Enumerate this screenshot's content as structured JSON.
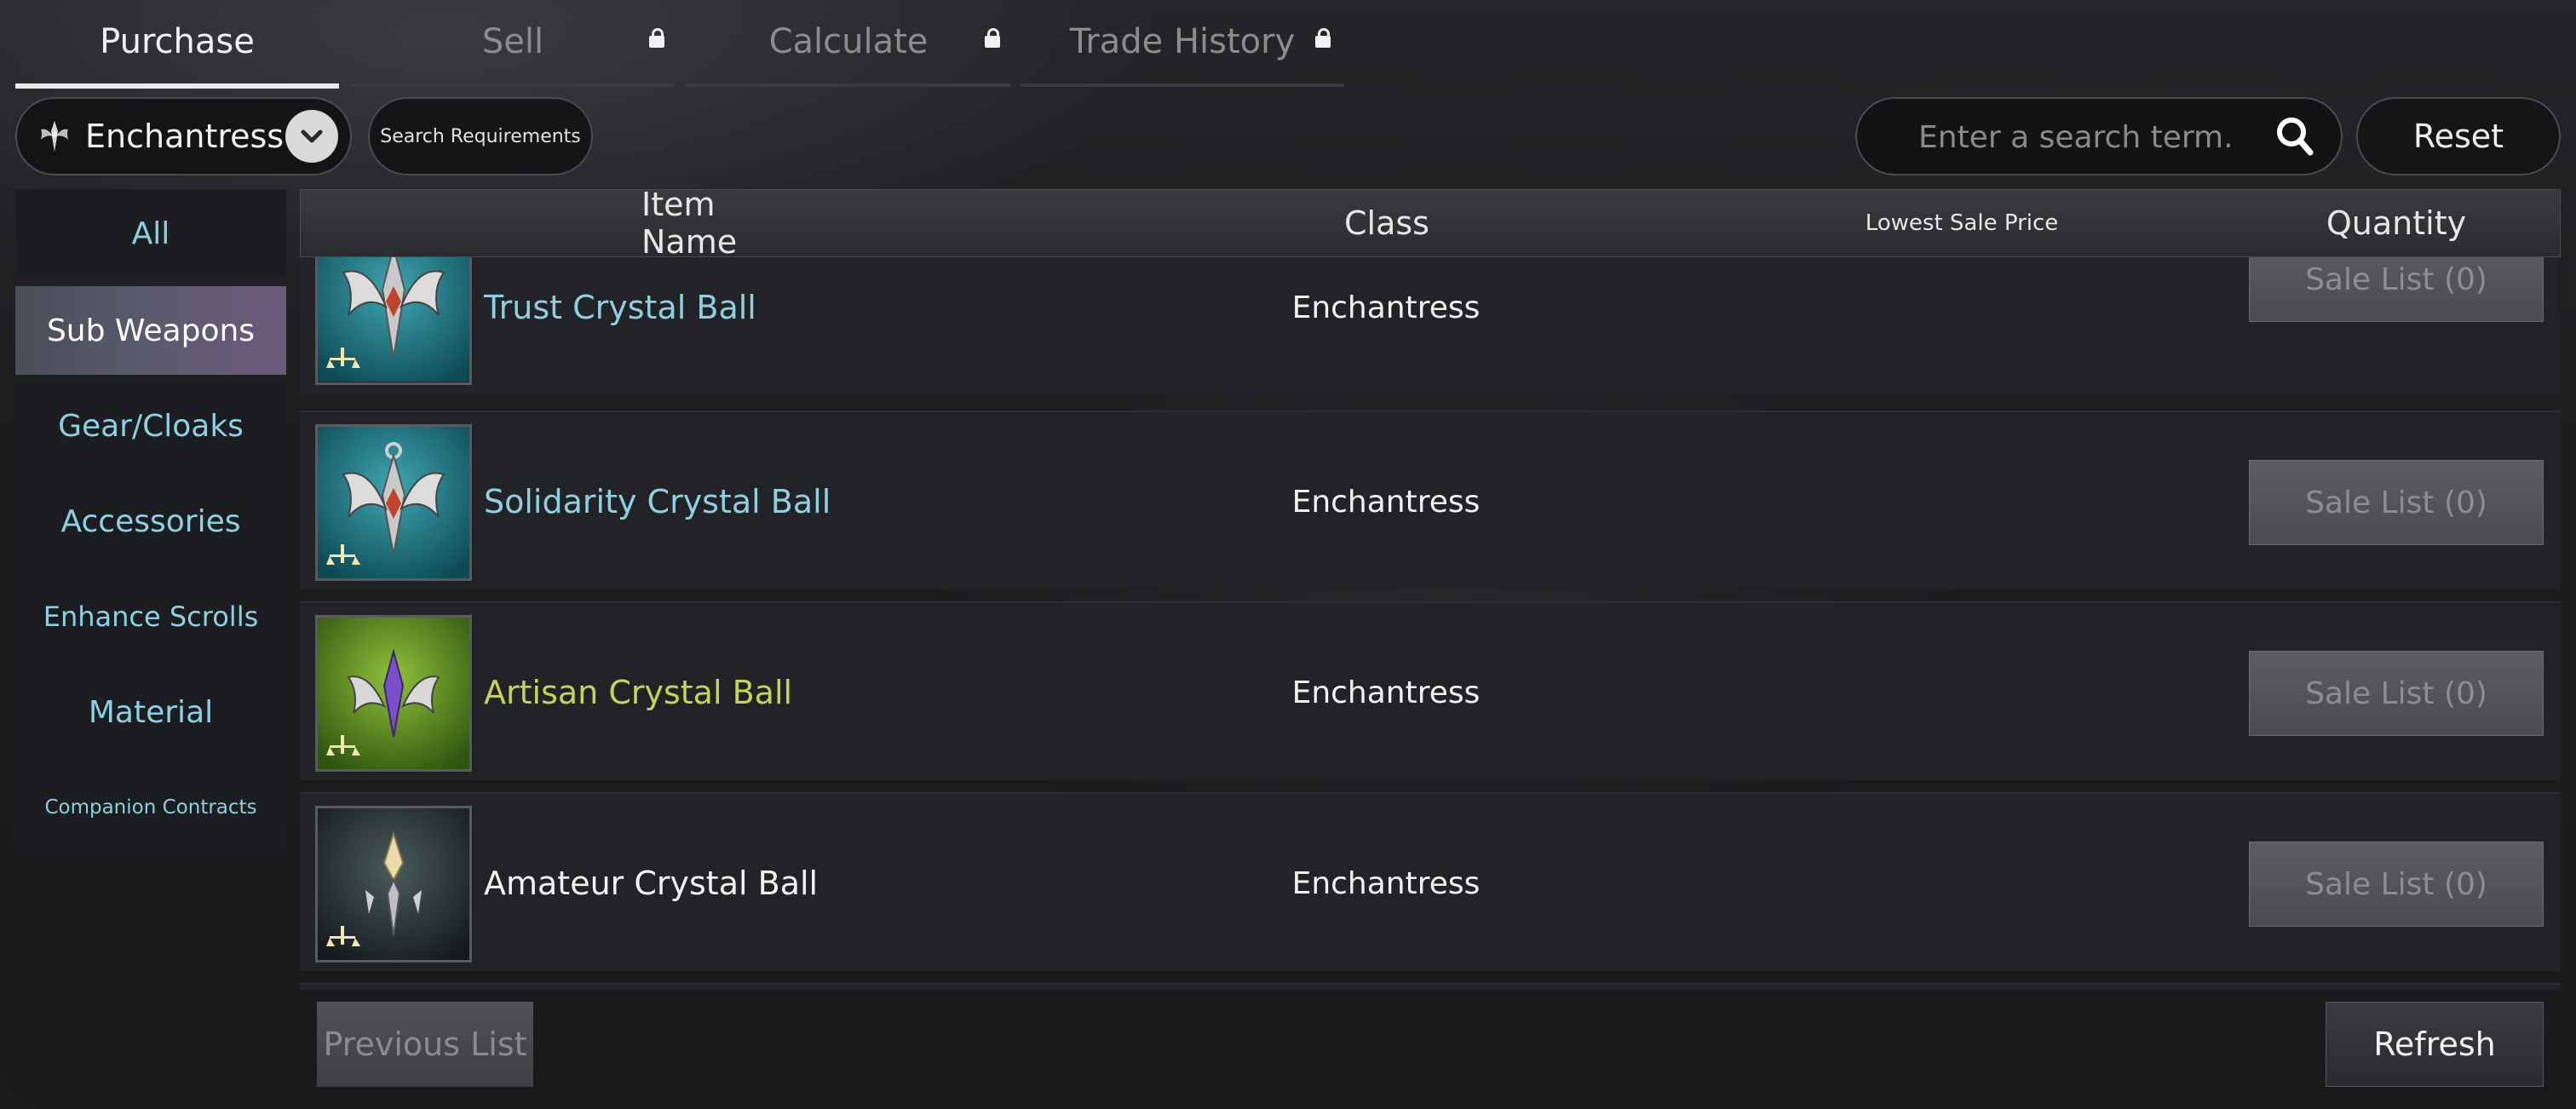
{
  "tabs": [
    {
      "label": "Purchase",
      "active": true,
      "locked": false
    },
    {
      "label": "Sell",
      "active": false,
      "locked": true
    },
    {
      "label": "Calculate",
      "active": false,
      "locked": true
    },
    {
      "label": "Trade History",
      "active": false,
      "locked": true
    }
  ],
  "filters": {
    "class_selected": "Enchantress",
    "class_icon": "enchantress-emblem-icon",
    "search_requirements_label": "Search Requirements",
    "search_placeholder": "Enter a search term.",
    "reset_label": "Reset"
  },
  "sidebar": {
    "items": [
      {
        "label": "All",
        "active": false
      },
      {
        "label": "Sub Weapons",
        "active": true
      },
      {
        "label": "Gear/Cloaks",
        "active": false
      },
      {
        "label": "Accessories",
        "active": false
      },
      {
        "label": "Enhance Scrolls",
        "active": false
      },
      {
        "label": "Material",
        "active": false
      },
      {
        "label": "Companion Contracts",
        "active": false
      }
    ]
  },
  "table": {
    "headers": {
      "item_name": "Item Name",
      "class": "Class",
      "lowest_sale_price": "Lowest Sale Price",
      "quantity": "Quantity"
    },
    "rows": [
      {
        "name": "Trust Crystal Ball",
        "class": "Enchantress",
        "action": "Sale List (0)",
        "name_color": "#8ecfe0",
        "icon": "trust-crystal-ball-icon"
      },
      {
        "name": "Solidarity Crystal Ball",
        "class": "Enchantress",
        "action": "Sale List (0)",
        "name_color": "#8ecfe0",
        "icon": "solidarity-crystal-ball-icon"
      },
      {
        "name": "Artisan Crystal Ball",
        "class": "Enchantress",
        "action": "Sale List (0)",
        "name_color": "#c8d25a",
        "icon": "artisan-crystal-ball-icon"
      },
      {
        "name": "Amateur Crystal Ball",
        "class": "Enchantress",
        "action": "Sale List (0)",
        "name_color": "#f2f2f2",
        "icon": "amateur-crystal-ball-icon"
      }
    ]
  },
  "footer": {
    "previous_label": "Previous List",
    "refresh_label": "Refresh"
  },
  "colors": {
    "accent_blue": "#8ecfe0",
    "rare_green": "#c8d25a"
  }
}
